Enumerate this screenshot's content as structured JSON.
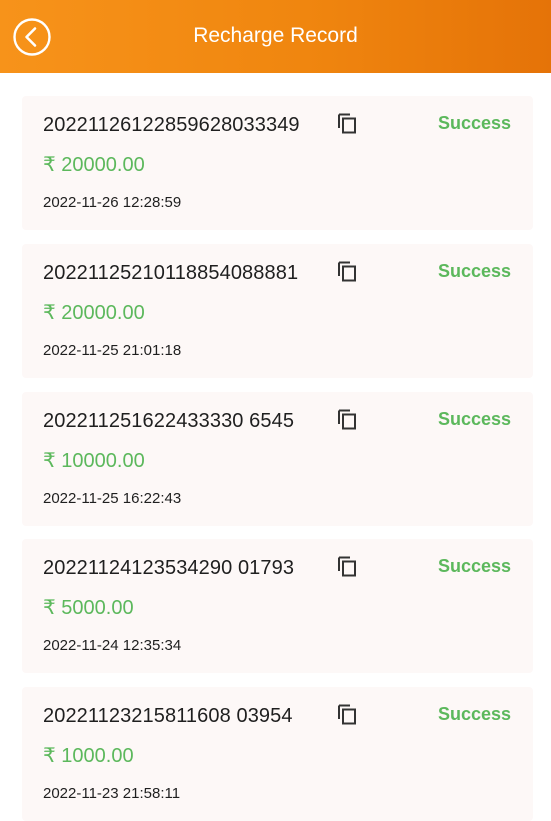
{
  "header": {
    "title": "Recharge Record",
    "back_icon": "back-arrow-circle-icon"
  },
  "colors": {
    "header_start": "#f7931a",
    "header_end": "#e57308",
    "success": "#5cb85c",
    "card_bg": "#fdf8f7"
  },
  "records": [
    {
      "order_no": "20221126122859628033349",
      "status": "Success",
      "amount": "₹ 20000.00",
      "date": "2022-11-26 12:28:59",
      "copy_icon": "copy-icon"
    },
    {
      "order_no": "20221125210118854088881",
      "status": "Success",
      "amount": "₹ 20000.00",
      "date": "2022-11-25 21:01:18",
      "copy_icon": "copy-icon"
    },
    {
      "order_no": "202211251622433330 6545",
      "status": "Success",
      "amount": "₹ 10000.00",
      "date": "2022-11-25 16:22:43",
      "copy_icon": "copy-icon"
    },
    {
      "order_no": "20221124123534290 01793",
      "status": "Success",
      "amount": "₹ 5000.00",
      "date": "2022-11-24 12:35:34",
      "copy_icon": "copy-icon"
    },
    {
      "order_no": "20221123215811608 03954",
      "status": "Success",
      "amount": "₹ 1000.00",
      "date": "2022-11-23 21:58:11",
      "copy_icon": "copy-icon"
    }
  ]
}
